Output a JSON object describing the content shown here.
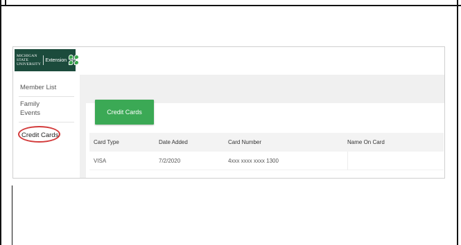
{
  "sidebar": {
    "logo": {
      "university_line1": "MICHIGAN STATE",
      "university_line2": "UNIVERSITY",
      "extension": "Extension",
      "emblem": "H"
    },
    "items": [
      {
        "label": "Member List"
      },
      {
        "label": "Family"
      },
      {
        "label": "Events"
      },
      {
        "label": "Credit Cards",
        "active": true
      }
    ]
  },
  "main": {
    "add_button_label": "Credit Cards",
    "table": {
      "headers": [
        "Card Type",
        "Date Added",
        "Card Number",
        "Name On Card"
      ],
      "rows": [
        {
          "card_type": "VISA",
          "date_added": "7/2/2020",
          "card_number": "4xxx xxxx xxxx 1300",
          "name_on_card": ""
        }
      ]
    }
  },
  "colors": {
    "accent_green": "#3ba955",
    "logo_green": "#1c4b3c",
    "highlight_circle": "#d33a3a"
  }
}
